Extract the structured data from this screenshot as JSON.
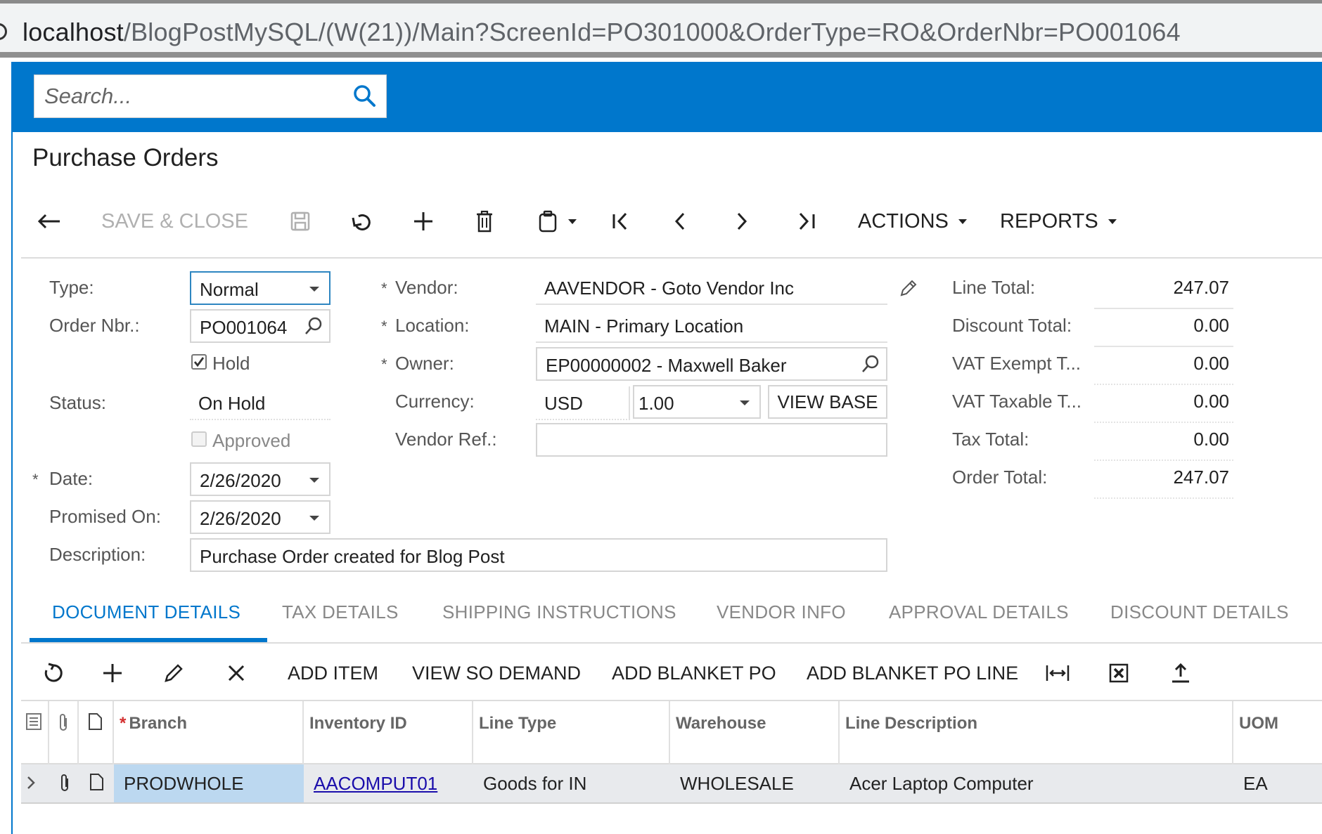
{
  "browser": {
    "host": "localhost",
    "path": "/BlogPostMySQL/(W(21))/Main?ScreenId=PO301000&OrderType=RO&OrderNbr=PO001064"
  },
  "search": {
    "placeholder": "Search..."
  },
  "page": {
    "title": "Purchase Orders"
  },
  "toolbar": {
    "save_close": "SAVE & CLOSE",
    "actions": "ACTIONS",
    "reports": "REPORTS"
  },
  "form": {
    "type_label": "Type:",
    "type_value": "Normal",
    "order_nbr_label": "Order Nbr.:",
    "order_nbr_value": "PO001064",
    "hold_label": "Hold",
    "hold_checked": true,
    "status_label": "Status:",
    "status_value": "On Hold",
    "approved_label": "Approved",
    "approved_checked": false,
    "date_label": "Date:",
    "date_value": "2/26/2020",
    "promised_label": "Promised On:",
    "promised_value": "2/26/2020",
    "description_label": "Description:",
    "description_value": "Purchase Order created for Blog Post",
    "vendor_label": "Vendor:",
    "vendor_value": "AAVENDOR - Goto Vendor Inc",
    "location_label": "Location:",
    "location_value": "MAIN - Primary Location",
    "owner_label": "Owner:",
    "owner_value": "EP00000002 - Maxwell Baker",
    "currency_label": "Currency:",
    "currency_value": "USD",
    "rate_value": "1.00",
    "view_base": "VIEW BASE",
    "vendor_ref_label": "Vendor Ref.:",
    "vendor_ref_value": "",
    "required_mark": "*"
  },
  "totals": {
    "line_total_label": "Line Total:",
    "line_total": "247.07",
    "discount_total_label": "Discount Total:",
    "discount_total": "0.00",
    "vat_exempt_label": "VAT Exempt T...",
    "vat_exempt": "0.00",
    "vat_taxable_label": "VAT Taxable T...",
    "vat_taxable": "0.00",
    "tax_total_label": "Tax Total:",
    "tax_total": "0.00",
    "order_total_label": "Order Total:",
    "order_total": "247.07"
  },
  "tabs": [
    {
      "label": "DOCUMENT DETAILS"
    },
    {
      "label": "TAX DETAILS"
    },
    {
      "label": "SHIPPING INSTRUCTIONS"
    },
    {
      "label": "VENDOR INFO"
    },
    {
      "label": "APPROVAL DETAILS"
    },
    {
      "label": "DISCOUNT DETAILS"
    }
  ],
  "grid_toolbar": {
    "add_item": "ADD ITEM",
    "view_so_demand": "VIEW SO DEMAND",
    "add_blanket_po": "ADD BLANKET PO",
    "add_blanket_po_line": "ADD BLANKET PO LINE"
  },
  "grid": {
    "columns": [
      "Branch",
      "Inventory ID",
      "Line Type",
      "Warehouse",
      "Line Description",
      "UOM"
    ],
    "rows": [
      {
        "branch": "PRODWHOLE",
        "inventory_id": "AACOMPUT01",
        "line_type": "Goods for IN",
        "warehouse": "WHOLESALE",
        "description": "Acer Laptop Computer",
        "uom": "EA"
      }
    ]
  },
  "colors": {
    "brand_blue": "#0077cc",
    "selected_cell": "#bcd8f0"
  }
}
